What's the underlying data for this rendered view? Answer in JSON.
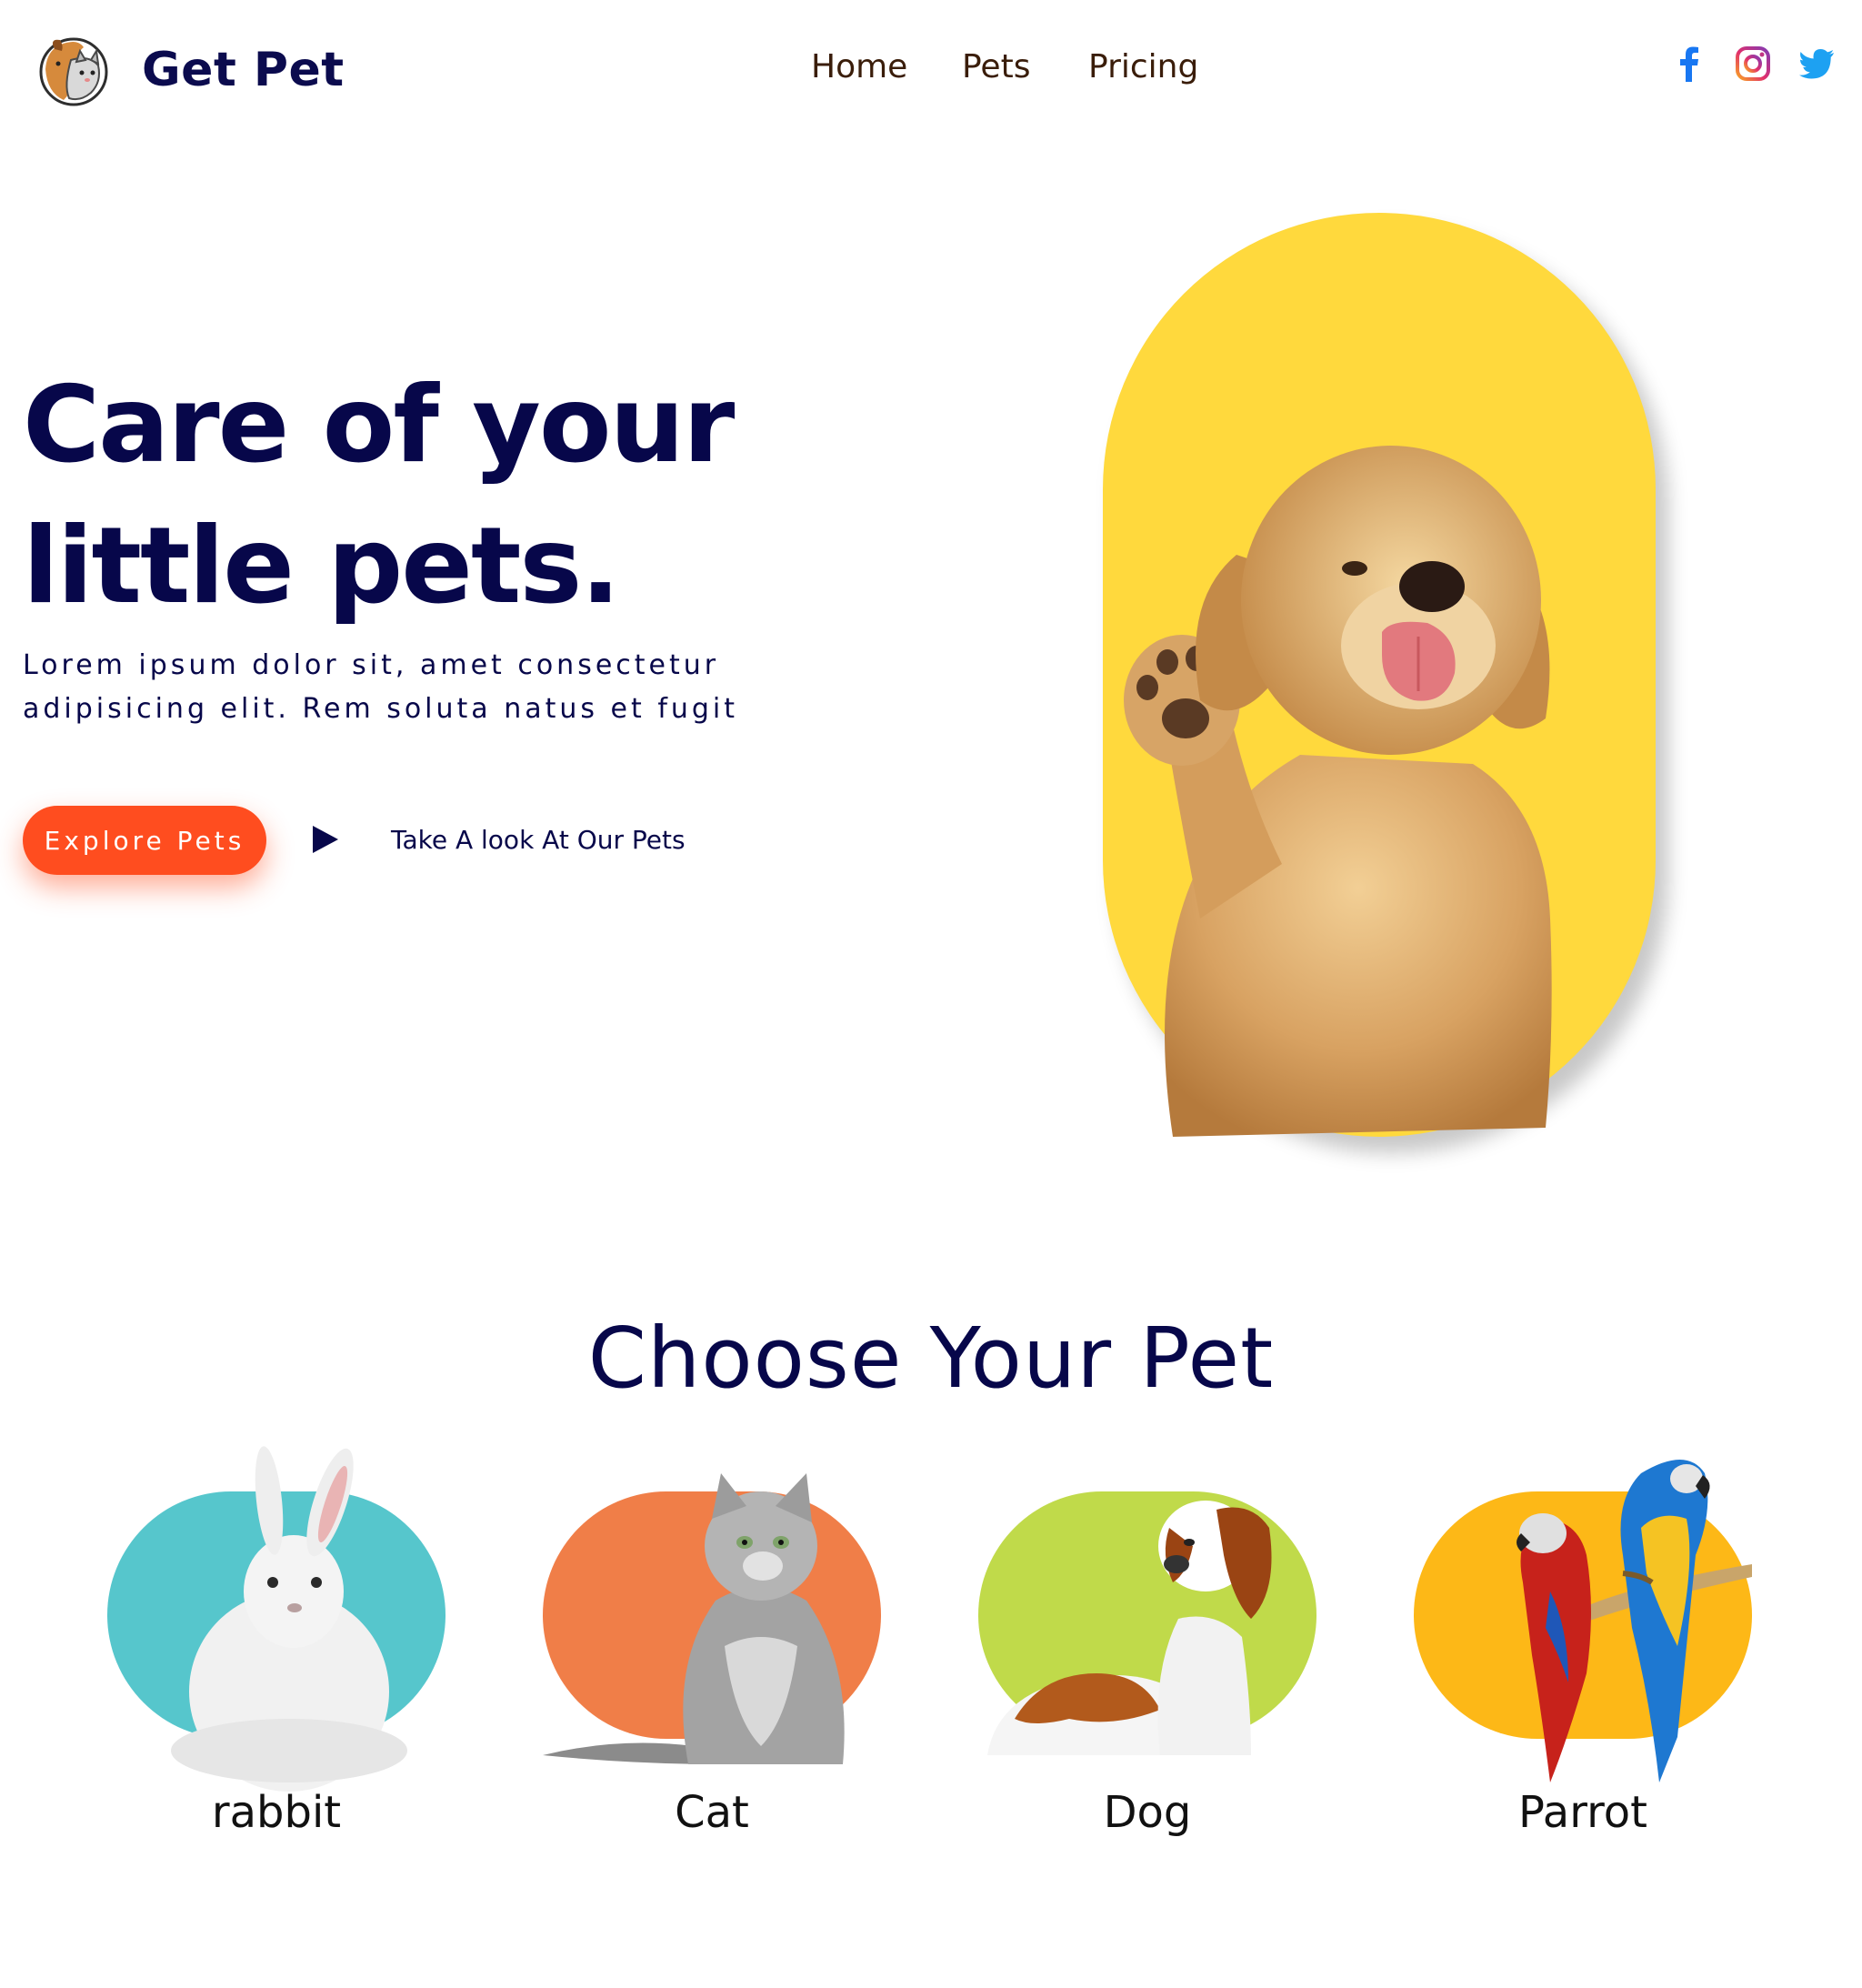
{
  "brand": {
    "name": "Get Pet",
    "logo_icon": "dog-and-cat-logo-icon"
  },
  "nav": {
    "links": [
      "Home",
      "Pets",
      "Pricing"
    ]
  },
  "socials": [
    {
      "name": "facebook-icon",
      "color": "#1877f2"
    },
    {
      "name": "instagram-icon",
      "color": "#c13584"
    },
    {
      "name": "twitter-icon",
      "color": "#1da1f2"
    }
  ],
  "hero": {
    "title_line1": "Care of your",
    "title_line2": "little pets.",
    "description": "Lorem ipsum dolor sit, amet consectetur adipisicing elit. Rem soluta natus et fugit",
    "explore_button": "Explore Pets",
    "look_link": "Take A look At Our Pets",
    "image_icon": "puppy-waving-image",
    "pill_color": "#ffd93d"
  },
  "choose": {
    "title": "Choose Your Pet",
    "pets": [
      {
        "label": "rabbit",
        "image": "rabbit-image",
        "color": "#56c6cc"
      },
      {
        "label": "Cat",
        "image": "cat-image",
        "color": "#f07e48"
      },
      {
        "label": "Dog",
        "image": "dog-image",
        "color": "#c0da4a"
      },
      {
        "label": "Parrot",
        "image": "parrot-image",
        "color": "#fdb817"
      }
    ]
  },
  "colors": {
    "primary_text": "#07074a",
    "accent": "#ff4d1f",
    "nav_text": "#3a1d0a"
  }
}
